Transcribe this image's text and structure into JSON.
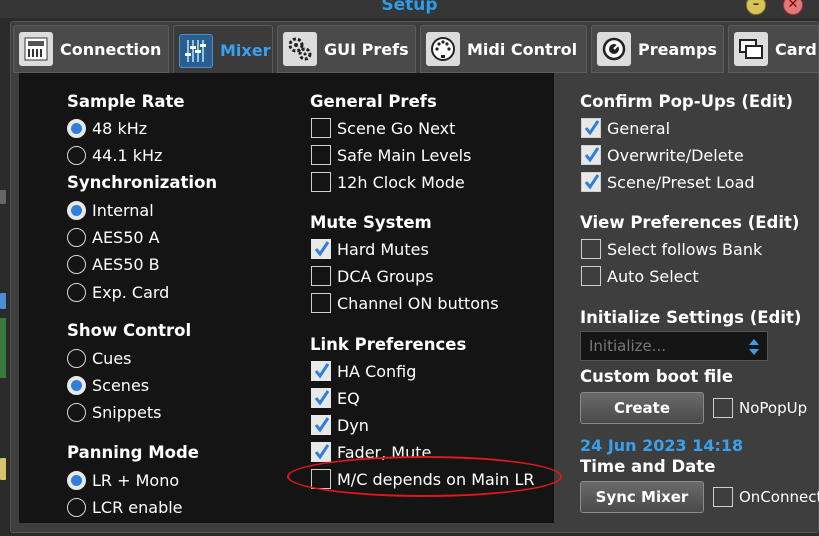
{
  "window": {
    "title": "Setup",
    "minimize_symbol": "–",
    "close_symbol": "✕"
  },
  "tabs": [
    {
      "label": "Connection",
      "icon": "mixer-device-icon",
      "active": false
    },
    {
      "label": "Mixer",
      "icon": "fader-icon",
      "active": true
    },
    {
      "label": "GUI Prefs",
      "icon": "gears-icon",
      "active": false
    },
    {
      "label": "Midi Control",
      "icon": "midi-connector-icon",
      "active": false
    },
    {
      "label": "Preamps",
      "icon": "preamp-knob-icon",
      "active": false
    },
    {
      "label": "Card",
      "icon": "card-icon",
      "active": false
    }
  ],
  "sample_rate": {
    "title": "Sample Rate",
    "options": [
      {
        "label": "48 kHz",
        "selected": true
      },
      {
        "label": "44.1 kHz",
        "selected": false
      }
    ]
  },
  "synchronization": {
    "title": "Synchronization",
    "options": [
      {
        "label": "Internal",
        "selected": true
      },
      {
        "label": "AES50 A",
        "selected": false
      },
      {
        "label": "AES50 B",
        "selected": false
      },
      {
        "label": "Exp. Card",
        "selected": false
      }
    ]
  },
  "show_control": {
    "title": "Show Control",
    "options": [
      {
        "label": "Cues",
        "selected": false
      },
      {
        "label": "Scenes",
        "selected": true
      },
      {
        "label": "Snippets",
        "selected": false
      }
    ]
  },
  "panning_mode": {
    "title": "Panning Mode",
    "options": [
      {
        "label": "LR + Mono",
        "selected": true
      },
      {
        "label": "LCR enable",
        "selected": false
      }
    ]
  },
  "general_prefs": {
    "title": "General Prefs",
    "options": [
      {
        "label": "Scene Go Next",
        "checked": false
      },
      {
        "label": "Safe Main Levels",
        "checked": false
      },
      {
        "label": "12h Clock Mode",
        "checked": false
      }
    ]
  },
  "mute_system": {
    "title": "Mute System",
    "options": [
      {
        "label": "Hard Mutes",
        "checked": true
      },
      {
        "label": "DCA Groups",
        "checked": false
      },
      {
        "label": "Channel ON buttons",
        "checked": false
      }
    ]
  },
  "link_preferences": {
    "title": "Link Preferences",
    "options": [
      {
        "label": "HA Config",
        "checked": true
      },
      {
        "label": "EQ",
        "checked": true
      },
      {
        "label": "Dyn",
        "checked": true
      },
      {
        "label": "Fader, Mute",
        "checked": true
      },
      {
        "label": "M/C depends on Main LR",
        "checked": false
      }
    ]
  },
  "confirm_popups": {
    "title": "Confirm Pop-Ups (Edit)",
    "options": [
      {
        "label": "General",
        "checked": true
      },
      {
        "label": "Overwrite/Delete",
        "checked": true
      },
      {
        "label": "Scene/Preset Load",
        "checked": true
      }
    ]
  },
  "view_preferences": {
    "title": "View Preferences (Edit)",
    "options": [
      {
        "label": "Select follows Bank",
        "checked": false
      },
      {
        "label": "Auto Select",
        "checked": false
      }
    ]
  },
  "initialize_settings": {
    "title": "Initialize Settings (Edit)",
    "placeholder": "Initialize..."
  },
  "custom_boot": {
    "title": "Custom boot file",
    "create_label": "Create",
    "nopopup_label": "NoPopUp",
    "nopopup_checked": false
  },
  "time_date": {
    "datetime": "24 Jun 2023 14:18",
    "title": "Time and Date",
    "sync_label": "Sync Mixer",
    "onconnect_label": "OnConnect",
    "onconnect_checked": false
  },
  "colors": {
    "accent": "#3aa0ee",
    "panel": "#141414",
    "annotation": "#e01818"
  }
}
